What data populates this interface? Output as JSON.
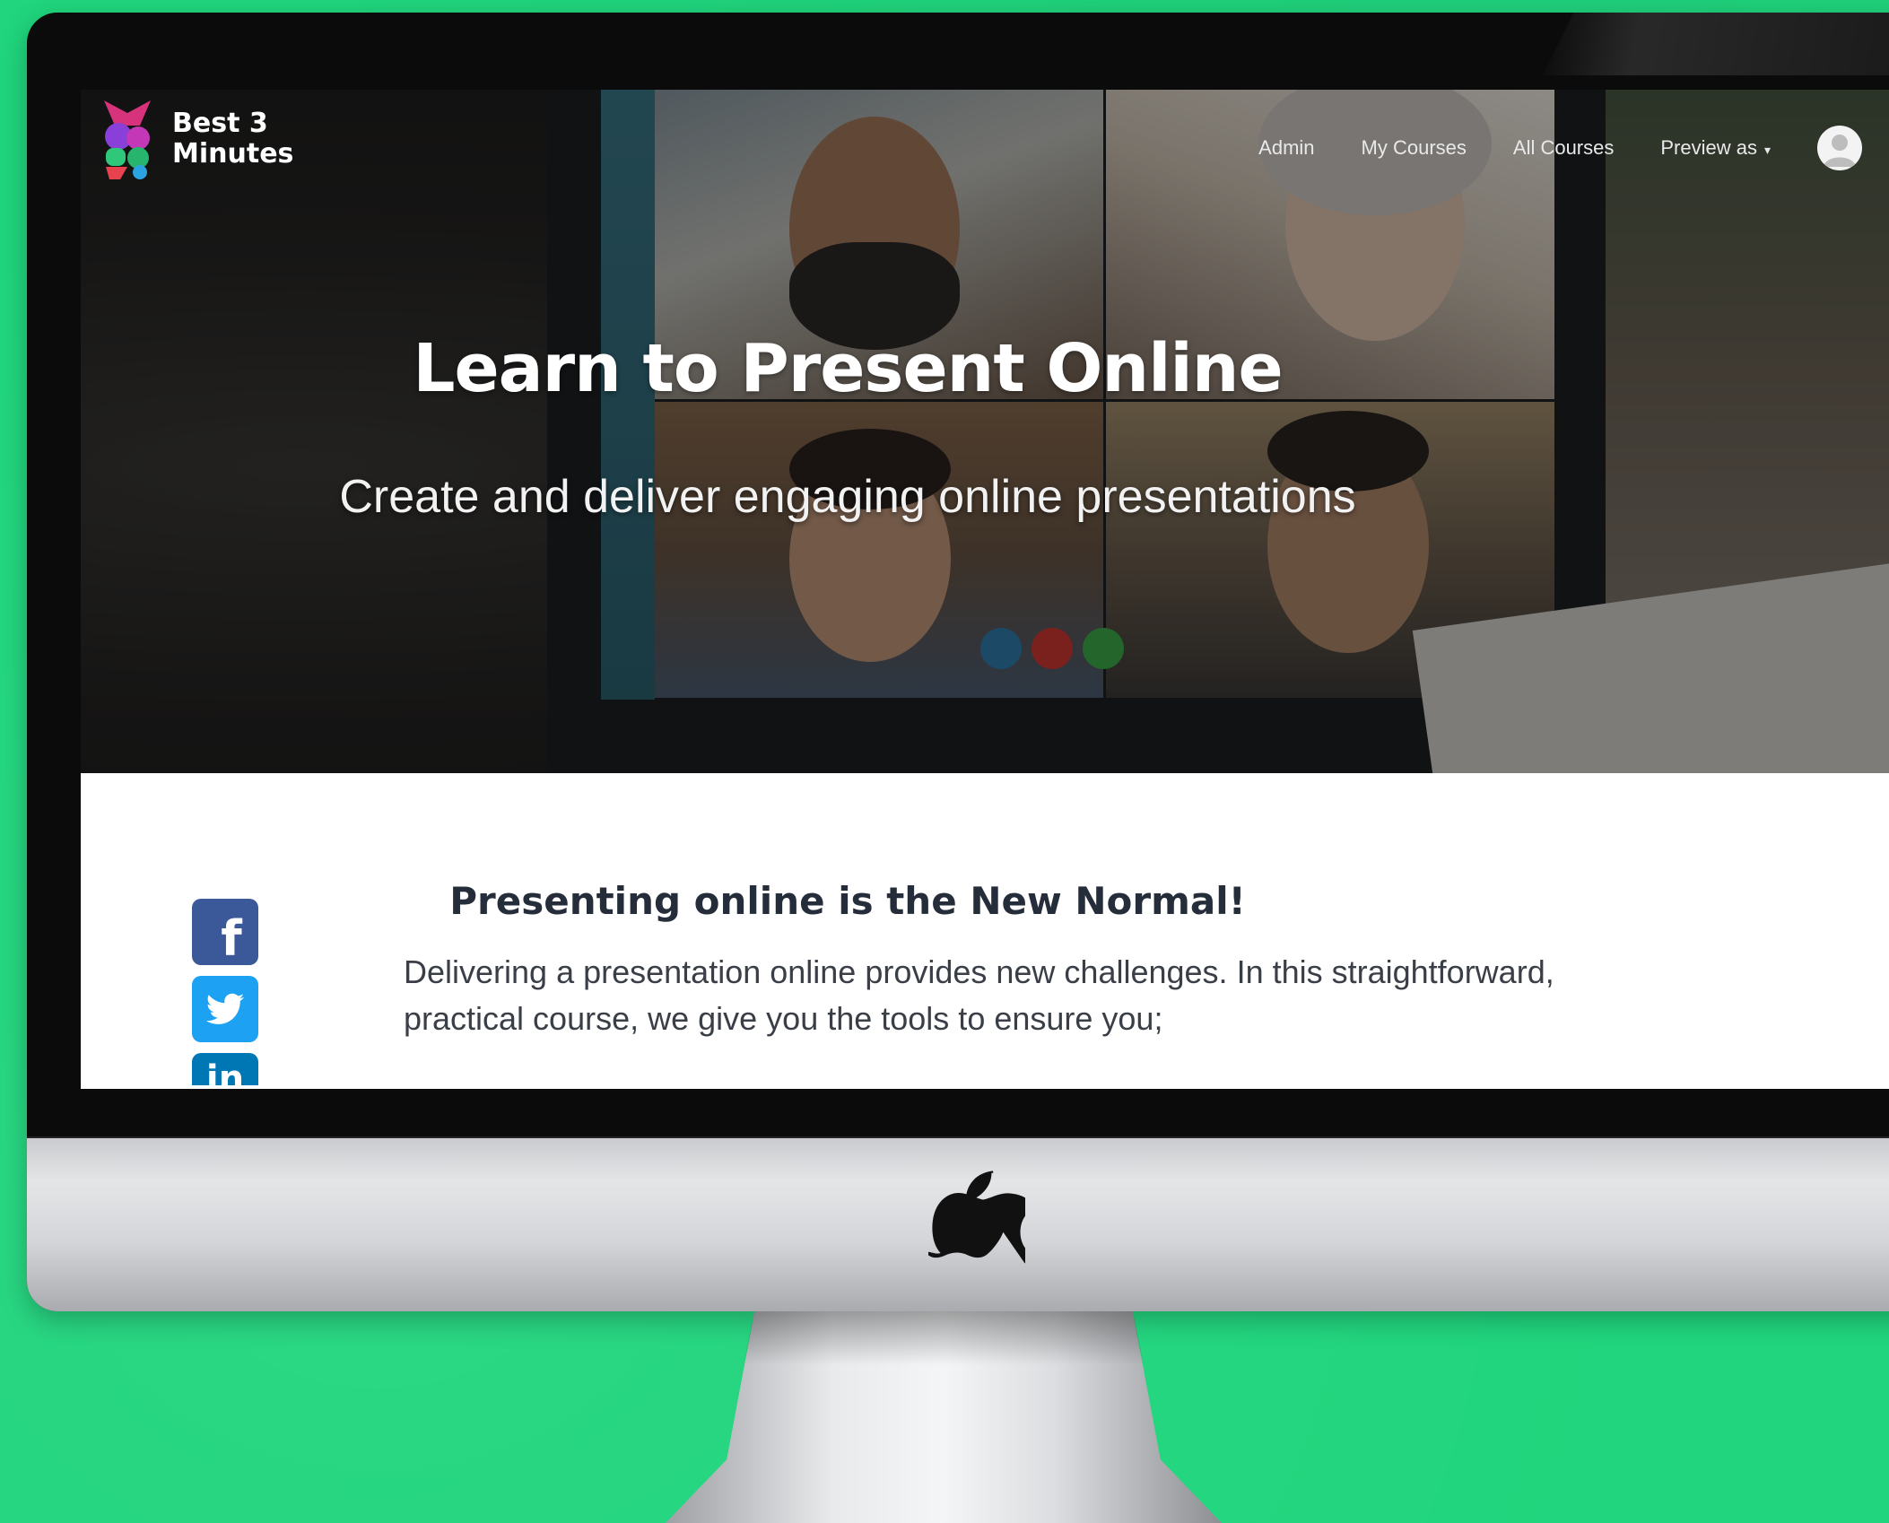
{
  "brand": {
    "name_line1": "Best 3",
    "name_line2": "Minutes"
  },
  "nav": {
    "items": [
      "Admin",
      "My Courses",
      "All Courses"
    ],
    "preview_label": "Preview as",
    "caret": "▾"
  },
  "hero": {
    "title": "Learn to Present Online",
    "subtitle": "Create and deliver engaging online presentations"
  },
  "section": {
    "title": "Presenting online is the New Normal!",
    "body": "Delivering a presentation online provides new challenges. In this straightforward, practical course, we give you the tools to ensure you;"
  },
  "social": [
    {
      "name": "facebook",
      "glyph": "f",
      "color": "#3b5998"
    },
    {
      "name": "twitter",
      "glyph": "",
      "color": "#1da1f2"
    },
    {
      "name": "linkedin",
      "glyph": "in",
      "color": "#0077b5"
    }
  ],
  "colors": {
    "background": "#20d57d",
    "title_text": "#262d3a"
  }
}
